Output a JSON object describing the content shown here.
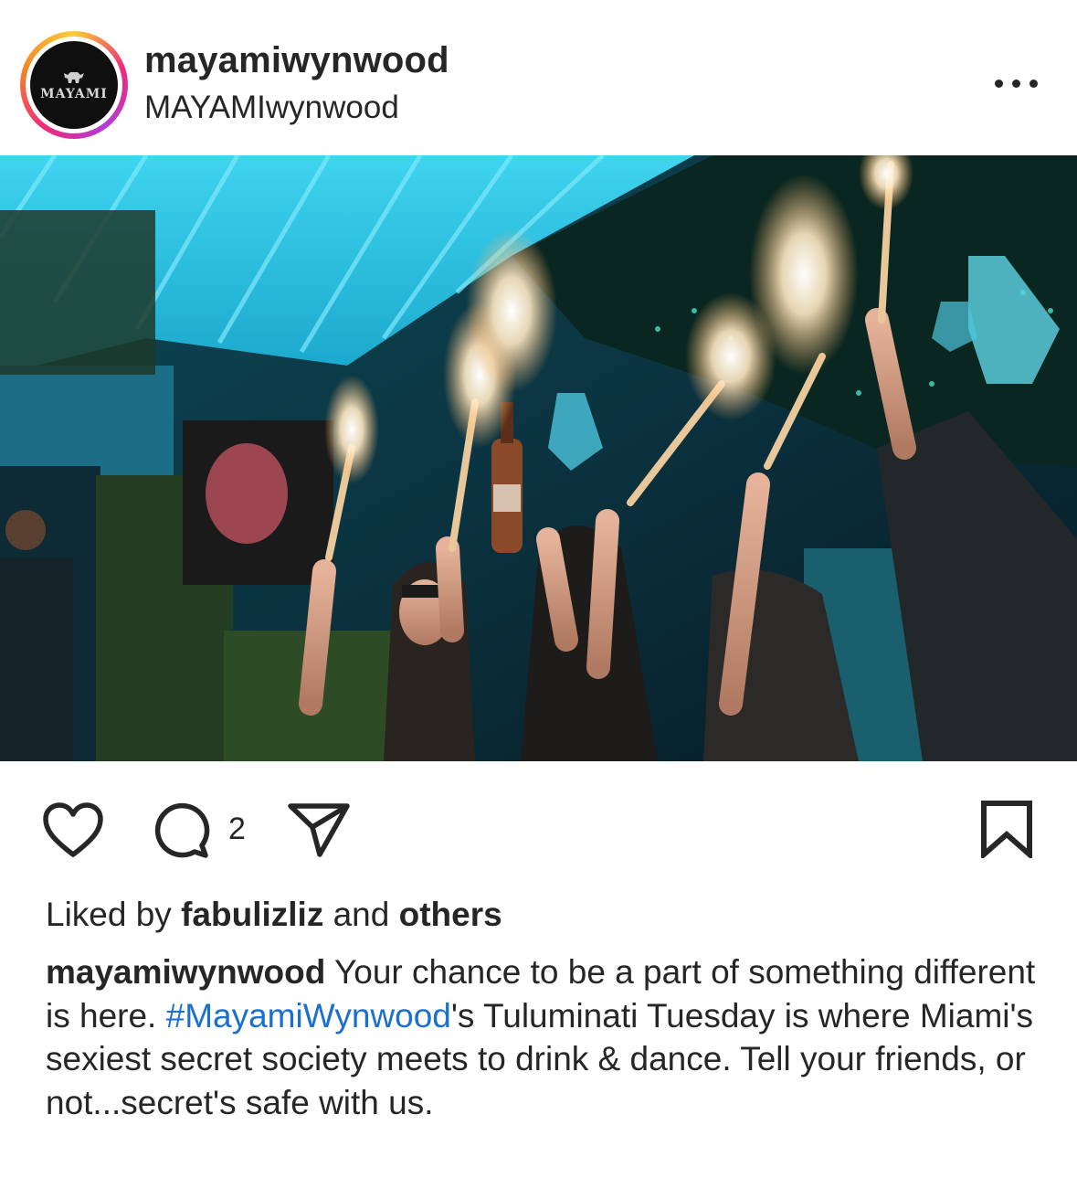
{
  "post": {
    "username": "mayamiwynwood",
    "subtitle": "MAYAMIwynwood",
    "avatar_text": "MAYAMI",
    "avatar_icon": "bull-logo-icon",
    "more_icon": "more-options-icon"
  },
  "photo": {
    "description_icon": "post-photo"
  },
  "actions": {
    "like_icon": "heart-icon",
    "comment_icon": "comment-icon",
    "comment_count": "2",
    "share_icon": "send-icon",
    "save_icon": "bookmark-icon"
  },
  "likes": {
    "prefix": "Liked by",
    "user": "fabulizliz",
    "connector": "and",
    "others": "others"
  },
  "caption": {
    "user": "mayamiwynwood",
    "text_before": " Your chance to be a part of something different is here. ",
    "hashtag": "#MayamiWynwood",
    "text_after": "'s Tuluminati Tuesday is where Miami's sexiest secret society meets to drink & dance. Tell your friends, or not...secret's safe with us."
  },
  "colors": {
    "text": "#262626",
    "hashtag": "#1a6fcf",
    "ring_start": "#f9ce34",
    "ring_end": "#ee2a7b"
  }
}
